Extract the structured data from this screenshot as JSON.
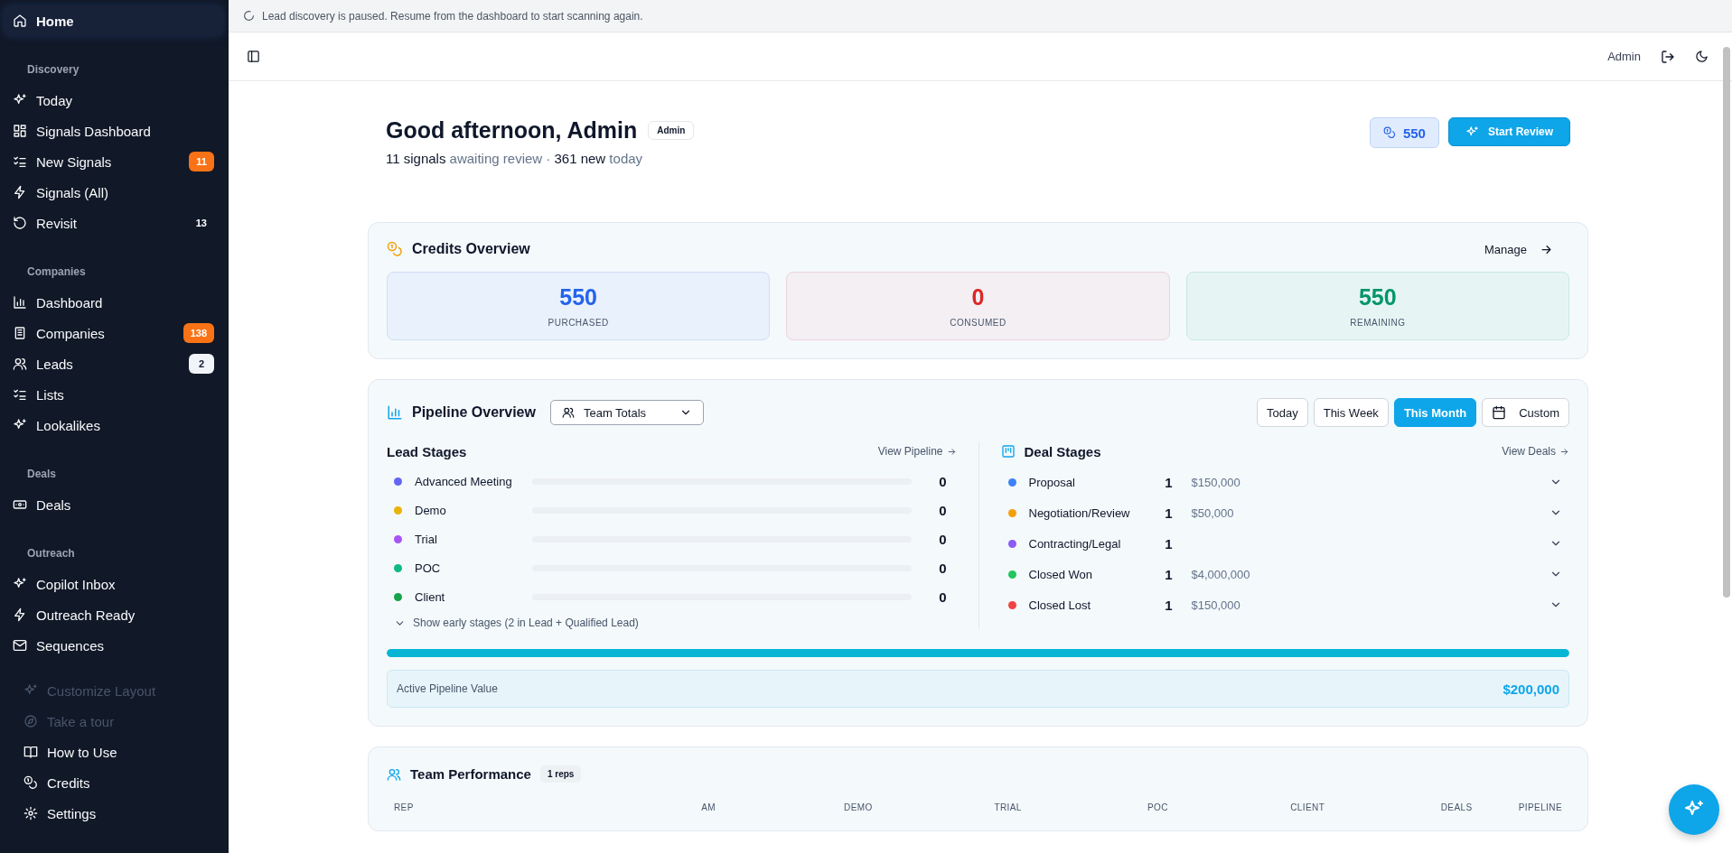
{
  "sidebar": {
    "home": {
      "label": "Home",
      "selected": true
    },
    "sections": [
      {
        "heading": "Discovery",
        "items": [
          {
            "label": "Today",
            "selected": false
          },
          {
            "label": "Signals Dashboard",
            "selected": false
          },
          {
            "label": "New Signals",
            "selected": false,
            "badge": "11",
            "kind": "alert"
          },
          {
            "label": "Signals (All)",
            "selected": false
          },
          {
            "label": "Revisit",
            "selected": false,
            "badge": "13",
            "kind": "plain"
          }
        ]
      },
      {
        "heading": "Companies",
        "items": [
          {
            "label": "Dashboard",
            "selected": false
          },
          {
            "label": "Companies",
            "selected": false,
            "badge": "138",
            "kind": "alert"
          },
          {
            "label": "Leads",
            "selected": false,
            "badge": "2",
            "kind": "light"
          },
          {
            "label": "Lists",
            "selected": false
          },
          {
            "label": "Lookalikes",
            "selected": false
          }
        ]
      },
      {
        "heading": "Deals",
        "items": [
          {
            "label": "Deals",
            "selected": false
          }
        ]
      },
      {
        "heading": "Outreach",
        "items": [
          {
            "label": "Copilot Inbox",
            "selected": false
          },
          {
            "label": "Outreach Ready",
            "selected": false
          },
          {
            "label": "Sequences",
            "selected": false
          }
        ]
      }
    ],
    "footer": [
      {
        "label": "Customize Layout",
        "disabled": true
      },
      {
        "label": "Take a tour",
        "disabled": true
      },
      {
        "label": "How to Use",
        "disabled": false
      },
      {
        "label": "Credits",
        "disabled": false
      },
      {
        "label": "Settings",
        "disabled": false
      }
    ]
  },
  "banner": {
    "text": "Lead discovery is paused. Resume from the dashboard to start scanning again."
  },
  "header": {
    "user": "Admin"
  },
  "greeting": {
    "title": "Good afternoon, Admin",
    "role_badge": "Admin",
    "summary": "**11 signals** awaiting review · **361 new** today",
    "credits": "550",
    "start_button": "Start Review"
  },
  "credits_overview": {
    "title": "Credits Overview",
    "manage": "Manage",
    "stats": [
      {
        "value": "550",
        "label": "PURCHASED",
        "kind": "purchased"
      },
      {
        "value": "0",
        "label": "CONSUMED",
        "kind": "consumed"
      },
      {
        "value": "550",
        "label": "REMAINING",
        "kind": "remaining"
      }
    ]
  },
  "pipeline": {
    "title": "Pipeline Overview",
    "team_select": "Team Totals",
    "ranges": [
      {
        "label": "Today",
        "selected": false
      },
      {
        "label": "This Week",
        "selected": false
      },
      {
        "label": "This Month",
        "selected": true
      },
      {
        "label": "Custom",
        "selected": false
      }
    ],
    "lead_stages": {
      "title": "Lead Stages",
      "link": "View Pipeline",
      "stages": [
        {
          "label": "Advanced Meeting",
          "color": "#6366f1",
          "level": 0,
          "count": "0"
        },
        {
          "label": "Demo",
          "color": "#eab308",
          "level": 0,
          "count": "0"
        },
        {
          "label": "Trial",
          "color": "#a855f7",
          "level": 0,
          "count": "0"
        },
        {
          "label": "POC",
          "color": "#10b981",
          "level": 0,
          "count": "0"
        },
        {
          "label": "Client",
          "color": "#16a34a",
          "level": 0,
          "count": "0"
        }
      ],
      "toggle": "Show early stages (2 in Lead + Qualified Lead)",
      "expanded": false
    },
    "deal_stages": {
      "title": "Deal Stages",
      "link": "View Deals",
      "stages": [
        {
          "label": "Proposal",
          "color": "#3b82f6",
          "count": "1",
          "amount": "$150,000"
        },
        {
          "label": "Negotiation/Review",
          "color": "#f59e0b",
          "count": "1",
          "amount": "$50,000"
        },
        {
          "label": "Contracting/Legal",
          "color": "#8b5cf6",
          "count": "1"
        },
        {
          "label": "Closed Won",
          "color": "#22c55e",
          "count": "1",
          "amount": "$4,000,000"
        },
        {
          "label": "Closed Lost",
          "color": "#ef4444",
          "count": "1",
          "amount": "$150,000"
        }
      ]
    },
    "progress": {
      "level": 1
    },
    "active_value": {
      "label": "Active Pipeline Value",
      "value": "$200,000"
    }
  },
  "team_performance": {
    "title": "Team Performance",
    "badge": "1 reps",
    "columns": [
      "REP",
      "AM",
      "DEMO",
      "TRIAL",
      "POC",
      "CLIENT",
      "DEALS",
      "PIPELINE"
    ]
  }
}
